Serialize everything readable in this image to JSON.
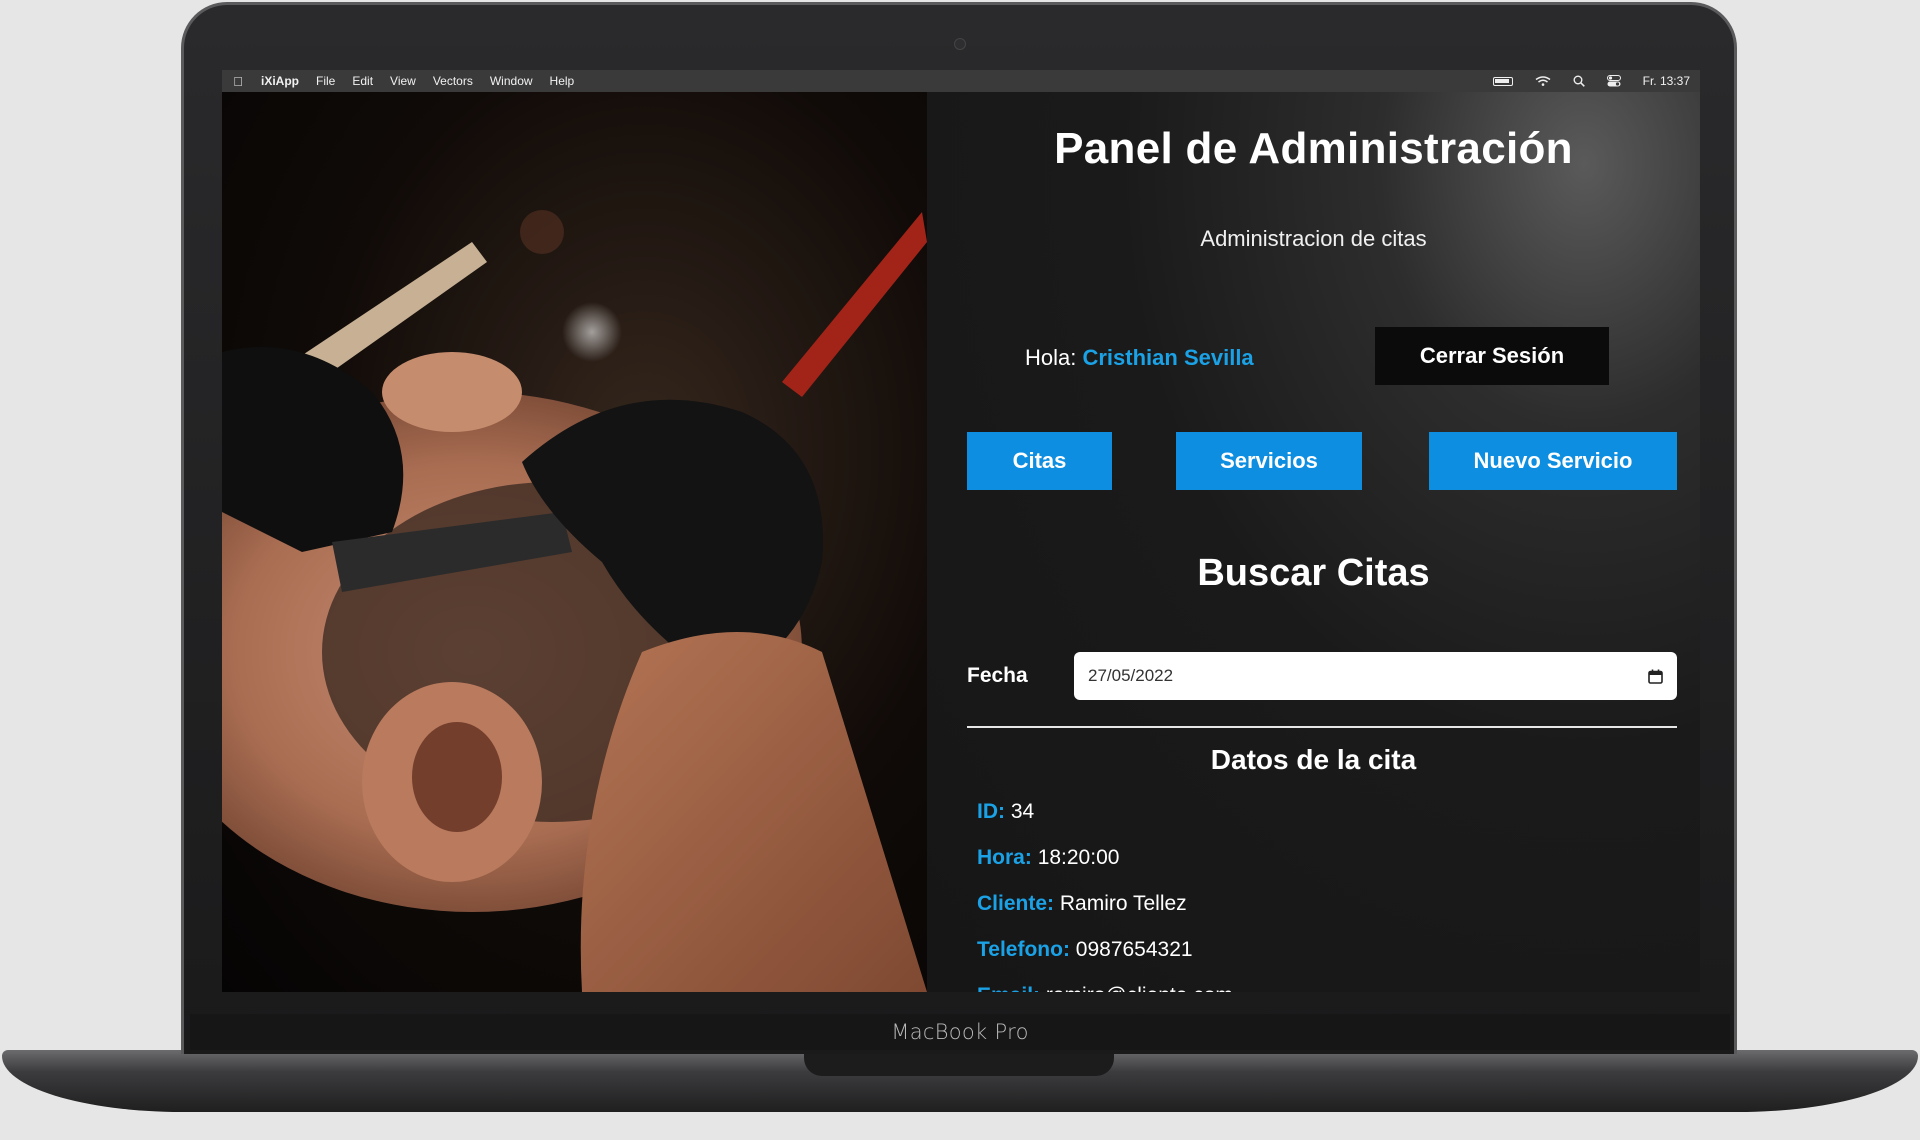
{
  "device": {
    "model_label": "MacBook Pro"
  },
  "menubar": {
    "app_name": "iXiApp",
    "menus": [
      "File",
      "Edit",
      "View",
      "Vectors",
      "Window",
      "Help"
    ],
    "clock": "Fr. 13:37",
    "status_icons": [
      "battery-icon",
      "wifi-icon",
      "search-icon",
      "control-center-icon"
    ]
  },
  "photo": {
    "subject": "barber-shave-photo"
  },
  "panel": {
    "title": "Panel de Administración",
    "subtitle": "Administracion de citas",
    "greeting_prefix": "Hola:",
    "user_name": "Cristhian Sevilla",
    "logout_label": "Cerrar Sesión",
    "nav": {
      "citas": "Citas",
      "servicios": "Servicios",
      "nuevo_servicio": "Nuevo Servicio"
    },
    "search_title": "Buscar Citas",
    "date_label": "Fecha",
    "date_value": "27/05/2022",
    "details_title": "Datos de la cita",
    "appointment": {
      "id_label": "ID:",
      "id": "34",
      "hora_label": "Hora:",
      "hora": "18:20:00",
      "cliente_label": "Cliente:",
      "cliente": "Ramiro Tellez",
      "telefono_label": "Telefono:",
      "telefono": "0987654321",
      "email_label": "Email:",
      "email": "ramiro@cliente.com"
    }
  },
  "colors": {
    "accent": "#0d8ee0",
    "link": "#1aa1e6",
    "logout_bg": "#0b0b0b"
  }
}
